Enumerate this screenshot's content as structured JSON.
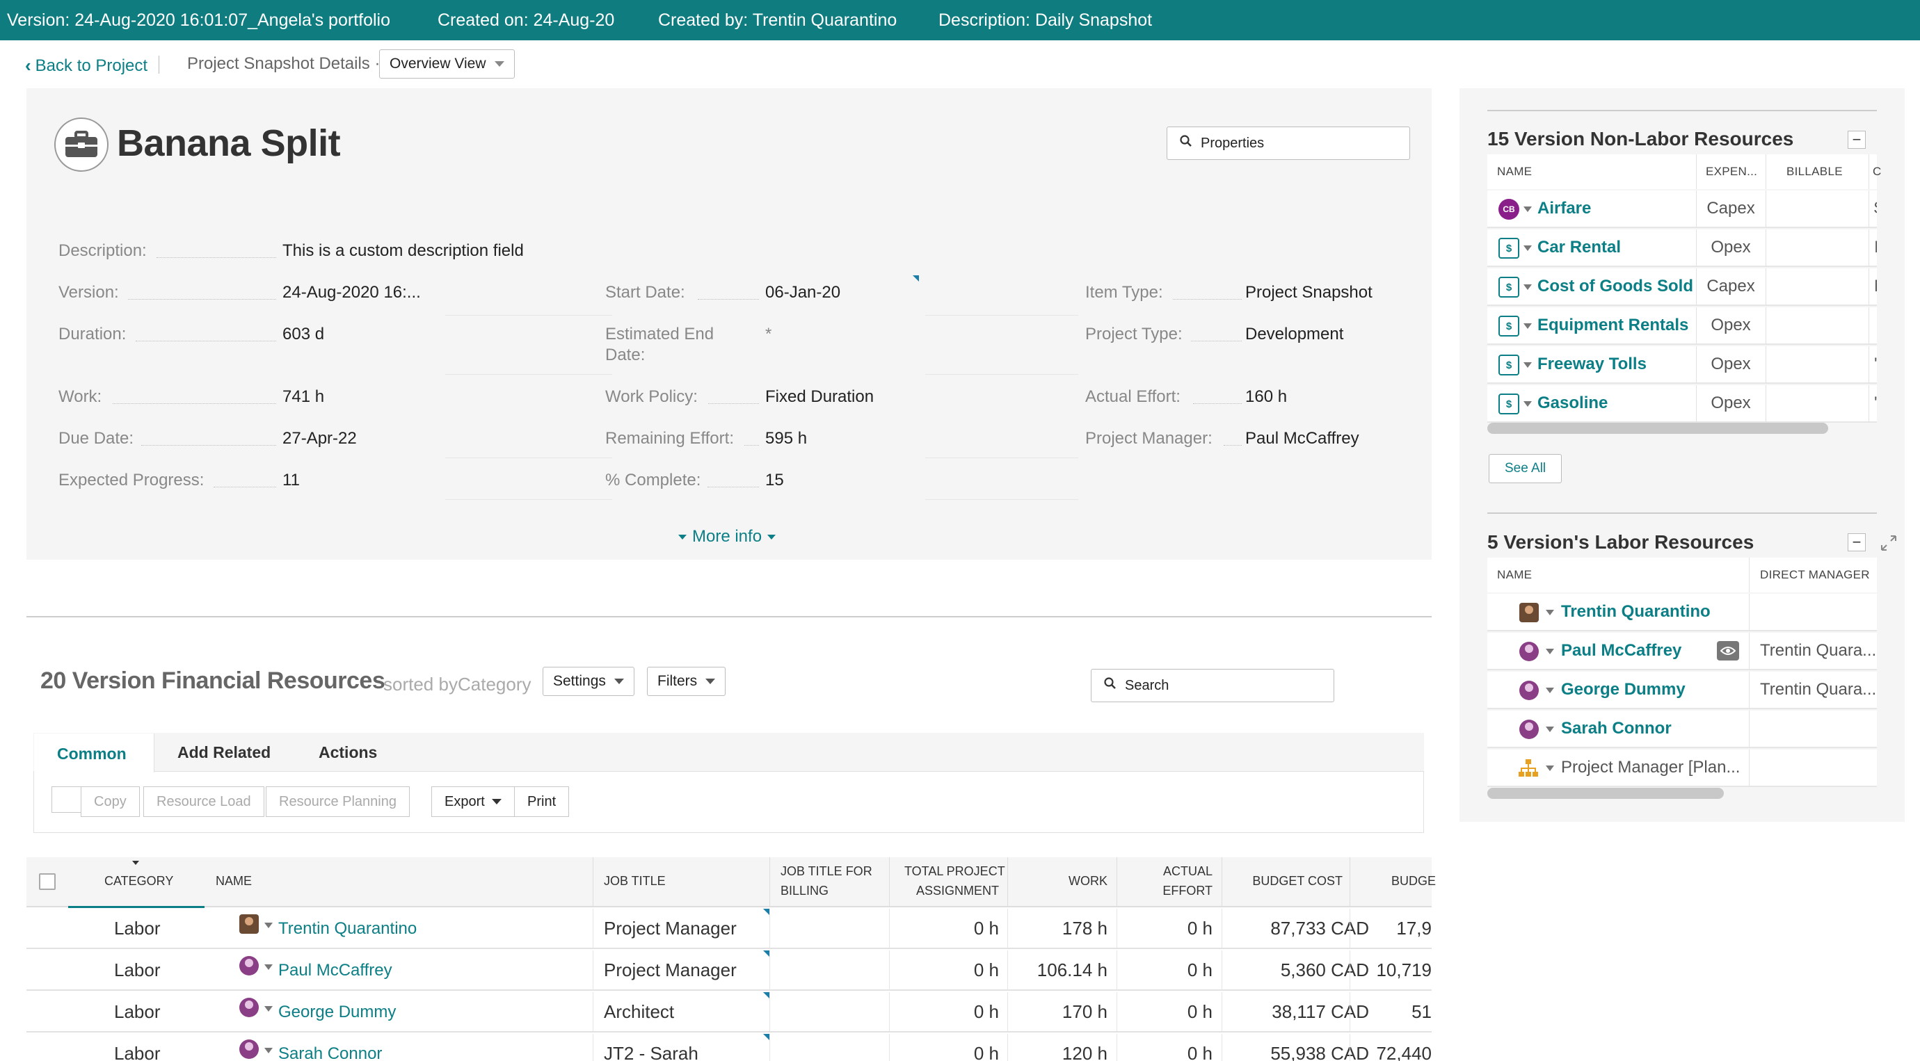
{
  "topbar": {
    "version": "Version: 24-Aug-2020 16:01:07_Angela's portfolio",
    "created_on": "Created on: 24-Aug-20",
    "created_by": "Created by: Trentin Quarantino",
    "description": "Description: Daily Snapshot"
  },
  "breadcrumb": {
    "back": "Back to Project",
    "current": "Project Snapshot Details ·",
    "view": "Overview View"
  },
  "project": {
    "title": "Banana Split",
    "properties_label": "Properties",
    "more_info": "More info",
    "fields": {
      "description_label": "Description:",
      "description_value": "This is a custom description field",
      "version_label": "Version:",
      "version_value": "24-Aug-2020 16:...",
      "duration_label": "Duration:",
      "duration_value": "603 d",
      "work_label": "Work:",
      "work_value": "741 h",
      "due_date_label": "Due Date:",
      "due_date_value": "27-Apr-22",
      "expected_progress_label": "Expected Progress:",
      "expected_progress_value": "11",
      "start_date_label": "Start Date:",
      "start_date_value": "06-Jan-20",
      "est_end_label_1": "Estimated End",
      "est_end_label_2": "Date:",
      "est_end_value": "*",
      "work_policy_label": "Work Policy:",
      "work_policy_value": "Fixed Duration",
      "remaining_effort_label": "Remaining Effort:",
      "remaining_effort_value": "595 h",
      "pct_complete_label": "% Complete:",
      "pct_complete_value": "15",
      "item_type_label": "Item Type:",
      "item_type_value": "Project Snapshot",
      "project_type_label": "Project Type:",
      "project_type_value": "Development",
      "actual_effort_label": "Actual Effort:",
      "actual_effort_value": "160 h",
      "project_manager_label": "Project Manager:",
      "project_manager_value": "Paul McCaffrey"
    }
  },
  "non_labor": {
    "title": "15 Version Non-Labor Resources",
    "columns": [
      "NAME",
      "EXPEN...",
      "BILLABLE",
      "C"
    ],
    "rows": [
      {
        "name": "Airfare",
        "expense": "Capex",
        "extra": "$",
        "icon": "cb-icon"
      },
      {
        "name": "Car Rental",
        "expense": "Opex",
        "extra": "I",
        "icon": "money-resource-icon"
      },
      {
        "name": "Cost of Goods Sold",
        "expense": "Capex",
        "extra": "N",
        "icon": "money-resource-icon"
      },
      {
        "name": "Equipment Rentals",
        "expense": "Opex",
        "extra": "",
        "icon": "money-resource-icon"
      },
      {
        "name": "Freeway Tolls",
        "expense": "Opex",
        "extra": "'",
        "icon": "money-resource-icon"
      },
      {
        "name": "Gasoline",
        "expense": "Opex",
        "extra": "'",
        "icon": "money-resource-icon"
      }
    ],
    "see_all": "See All"
  },
  "labor": {
    "title": "5 Version's Labor Resources",
    "columns": [
      "NAME",
      "DIRECT MANAGER"
    ],
    "rows": [
      {
        "name": "Trentin Quarantino",
        "manager": ""
      },
      {
        "name": "Paul McCaffrey",
        "manager": "Trentin Quara..."
      },
      {
        "name": "George Dummy",
        "manager": "Trentin Quara..."
      },
      {
        "name": "Sarah Connor",
        "manager": ""
      },
      {
        "name": "Project Manager [Plan...",
        "manager": ""
      }
    ]
  },
  "financial": {
    "title": "20 Version Financial Resources",
    "sorted_by": "sorted by",
    "sort_field": "Category",
    "settings": "Settings",
    "filters": "Filters",
    "search_placeholder": "Search",
    "tabs": [
      "Common",
      "Add Related",
      "Actions"
    ],
    "toolbar": {
      "copy": "Copy",
      "resource_load": "Resource Load",
      "resource_planning": "Resource Planning",
      "export": "Export",
      "print": "Print"
    },
    "columns": {
      "category": "CATEGORY",
      "name": "NAME",
      "job_title": "JOB TITLE",
      "job_title_billing_1": "JOB TITLE FOR",
      "job_title_billing_2": "BILLING",
      "total_assign_1": "TOTAL PROJECT",
      "total_assign_2": "ASSIGNMENT",
      "work": "WORK",
      "actual_effort_1": "ACTUAL",
      "actual_effort_2": "EFFORT",
      "budget_cost": "BUDGET COST",
      "budget_more": "BUDGE"
    },
    "rows": [
      {
        "category": "Labor",
        "name": "Trentin Quarantino",
        "job_title": "Project Manager",
        "total": "0 h",
        "work": "178 h",
        "actual": "0 h",
        "budget_cost": "87,733 CAD",
        "budget2": "17,9"
      },
      {
        "category": "Labor",
        "name": "Paul McCaffrey",
        "job_title": "Project Manager",
        "total": "0 h",
        "work": "106.14 h",
        "actual": "0 h",
        "budget_cost": "5,360 CAD",
        "budget2": "10,719"
      },
      {
        "category": "Labor",
        "name": "George Dummy",
        "job_title": "Architect",
        "total": "0 h",
        "work": "170 h",
        "actual": "0 h",
        "budget_cost": "38,117 CAD",
        "budget2": "51"
      },
      {
        "category": "Labor",
        "name": "Sarah Connor",
        "job_title": "JT2 - Sarah",
        "total": "0 h",
        "work": "120 h",
        "actual": "0 h",
        "budget_cost": "55,938 CAD",
        "budget2": "72,440"
      }
    ]
  }
}
